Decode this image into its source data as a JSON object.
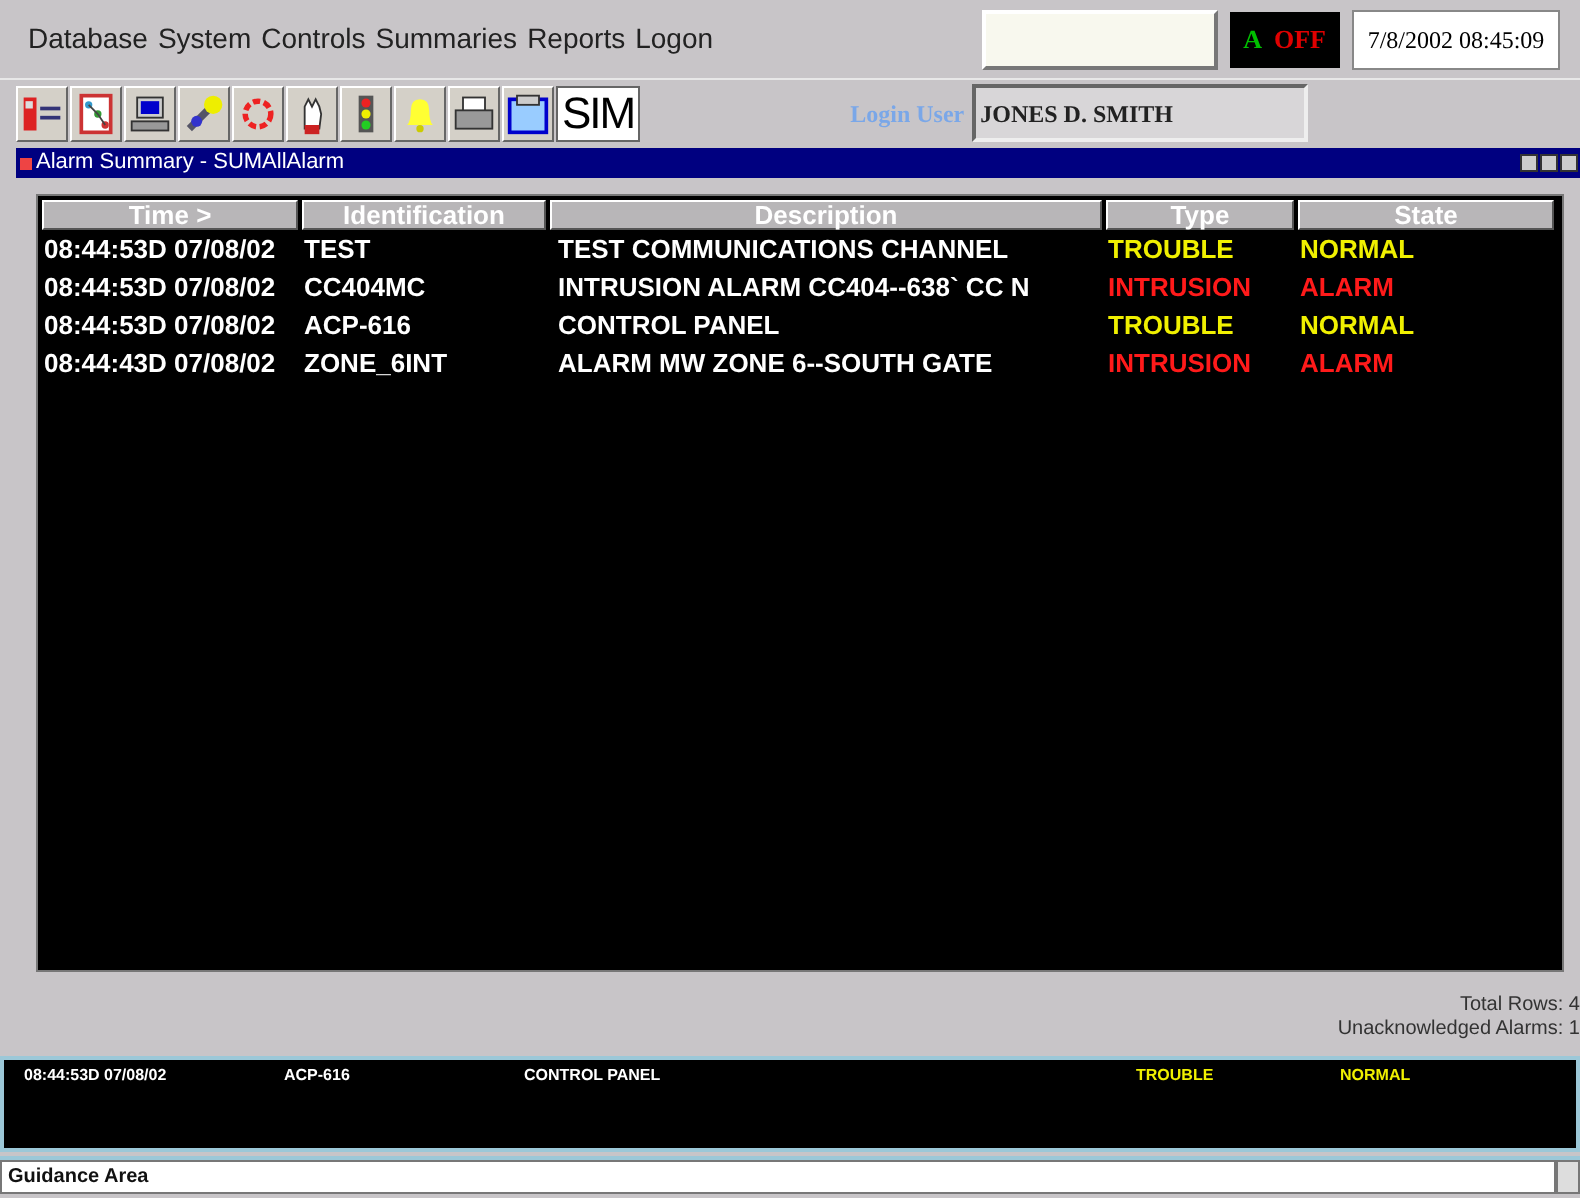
{
  "menu": [
    "Database",
    "System",
    "Controls",
    "Summaries",
    "Reports",
    "Logon"
  ],
  "status_indicator": {
    "left": "A",
    "right": "OFF"
  },
  "datetime": "7/8/2002 08:45:09",
  "toolbar": {
    "sim_label": "SIM"
  },
  "login": {
    "label": "Login User",
    "value": "JONES D. SMITH"
  },
  "window": {
    "title": "Alarm Summary - SUMAllAlarm"
  },
  "table": {
    "columns": [
      "Time >",
      "Identification",
      "Description",
      "Type",
      "State"
    ],
    "rows": [
      {
        "kind": "trouble",
        "cells": [
          "08:44:53D 07/08/02",
          "TEST",
          "TEST COMMUNICATIONS CHANNEL",
          "TROUBLE",
          "NORMAL"
        ]
      },
      {
        "kind": "alarm",
        "cells": [
          "08:44:53D 07/08/02",
          "CC404MC",
          "INTRUSION ALARM CC404--638` CC N",
          "INTRUSION",
          "ALARM"
        ]
      },
      {
        "kind": "trouble",
        "cells": [
          "08:44:53D 07/08/02",
          "ACP-616",
          "CONTROL PANEL",
          "TROUBLE",
          "NORMAL"
        ]
      },
      {
        "kind": "alarm",
        "cells": [
          "08:44:43D 07/08/02",
          "ZONE_6INT",
          "ALARM MW ZONE 6--SOUTH GATE",
          "INTRUSION",
          "ALARM"
        ]
      }
    ]
  },
  "totals": [
    "Total Rows:  4",
    "Unacknowledged Alarms: 1"
  ],
  "detail": {
    "kind": "trouble",
    "cells": [
      "08:44:53D 07/08/02",
      "ACP-616",
      "CONTROL PANEL",
      "TROUBLE",
      "NORMAL"
    ]
  },
  "guidance": "Guidance Area"
}
